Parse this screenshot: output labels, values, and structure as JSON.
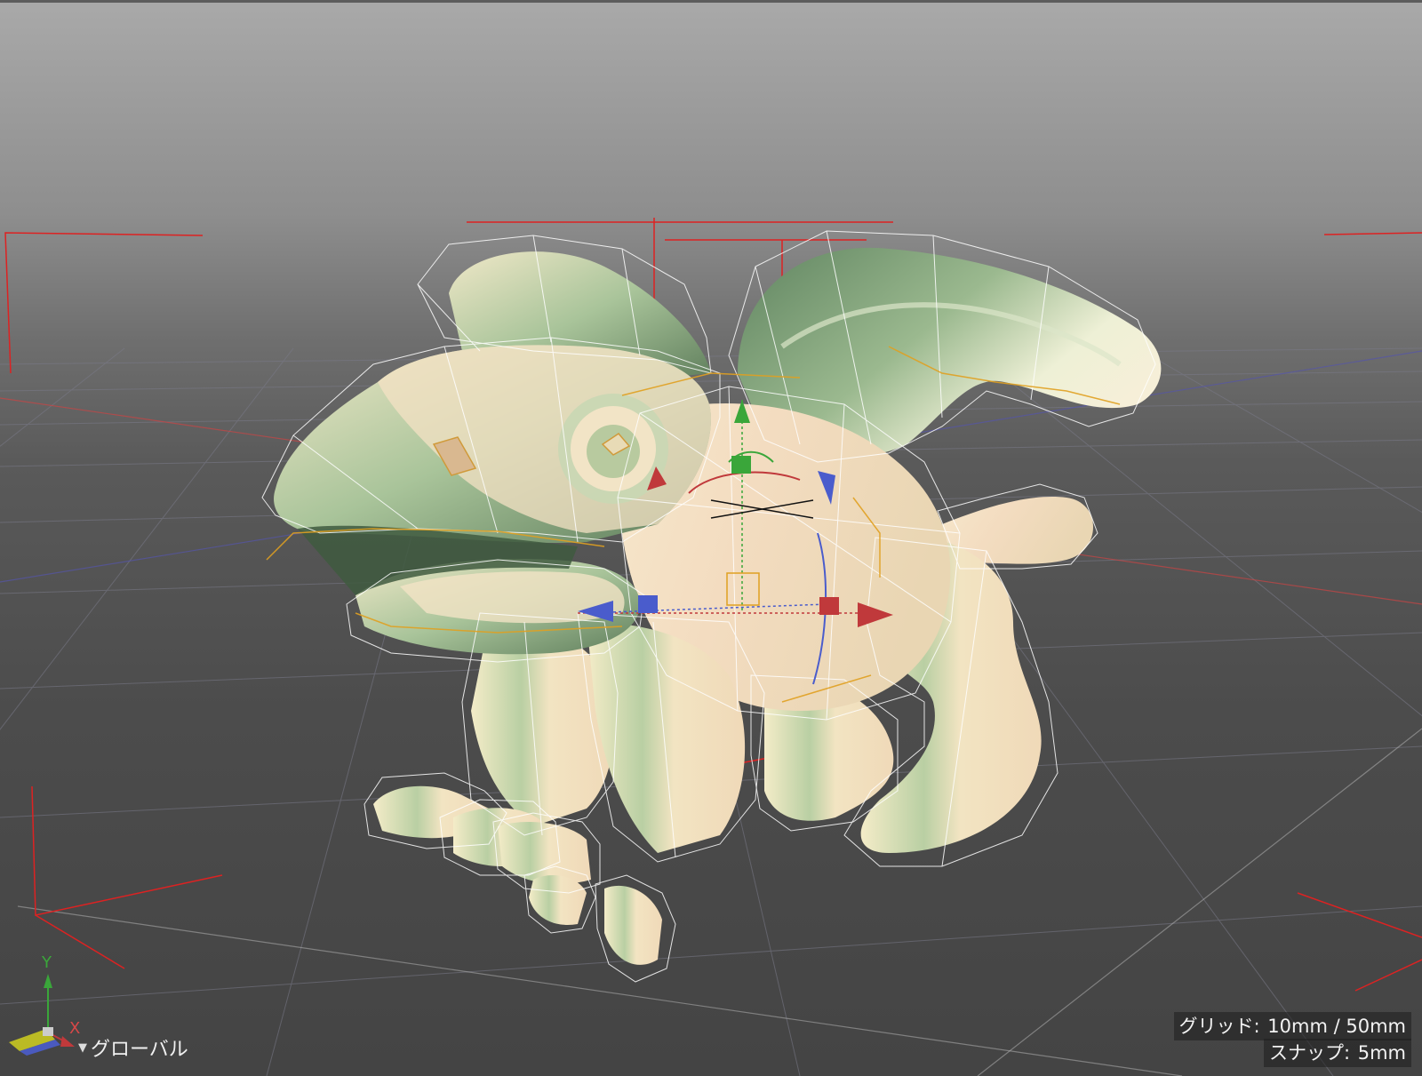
{
  "viewport": {
    "hud": {
      "grid_label": "グリッド:",
      "grid_value": "10mm / 50mm",
      "snap_label": "スナップ:",
      "snap_value": "5mm"
    },
    "coordinate_space": {
      "selected": "グローバル",
      "dropdown_icon": "triangle-down-icon"
    },
    "axis_indicator": {
      "y_label": "Y",
      "x_label": "X"
    }
  },
  "colors": {
    "axis_x": "#cc2222",
    "axis_y": "#22bb33",
    "axis_z": "#3355dd",
    "gizmo_x": "#c0393b",
    "gizmo_y": "#3aa63a",
    "gizmo_z": "#4a5ccc",
    "model_light": "#f7e6c8",
    "model_shadow": "#6f8f6a",
    "cage_wire": "#ffffff",
    "edge_highlight": "#e0a020"
  }
}
